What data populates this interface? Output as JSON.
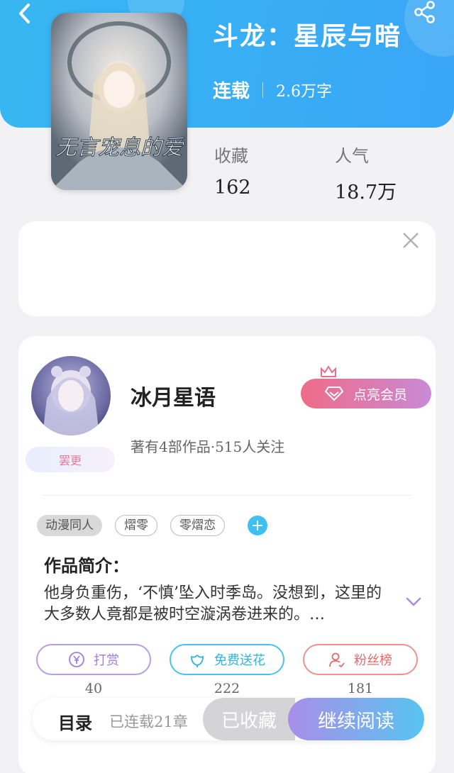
{
  "book": {
    "title": "斗龙：星辰与暗",
    "status": "连载",
    "word_count": "2.6万字",
    "cover_text": "无言宠息的爱"
  },
  "stats": {
    "favorites_label": "收藏",
    "favorites_value": "162",
    "popularity_label": "人气",
    "popularity_value": "18.7万"
  },
  "author": {
    "name": "冰月星语",
    "meta": "著有4部作品·515人关注",
    "badge": "罢更",
    "vip_label": "点亮会员"
  },
  "tags": [
    {
      "label": "动漫同人",
      "style": "filled"
    },
    {
      "label": "熠零",
      "style": "outline"
    },
    {
      "label": "零熠恋",
      "style": "outline"
    }
  ],
  "intro": {
    "title": "作品简介：",
    "text": "他身负重伤，‘不慎’坠入时季岛。没想到，这里的大多数人竟都是被时空漩涡卷进来的。…"
  },
  "actions": [
    {
      "label": "打赏",
      "count": "40",
      "icon": "yen-coin-icon"
    },
    {
      "label": "免费送花",
      "count": "222",
      "icon": "flower-icon"
    },
    {
      "label": "粉丝榜",
      "count": "181",
      "icon": "user-rank-icon"
    }
  ],
  "bottom": {
    "toc": "目录",
    "serial": "已连载21章",
    "favorited": "已收藏",
    "continue": "继续阅读"
  },
  "colors": {
    "hero_blue": "#3aa6f6",
    "accent_cyan": "#3ec0f0",
    "vip_pink": "#f06b88",
    "vip_purple": "#c88ad6"
  }
}
